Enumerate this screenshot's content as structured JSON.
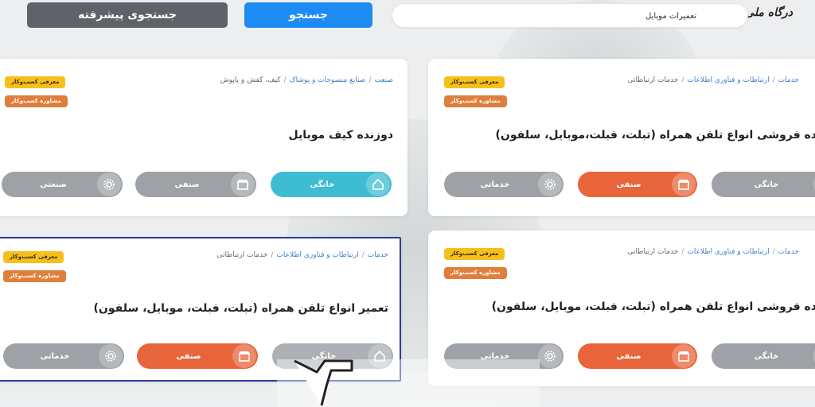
{
  "header": {
    "logo_text": "درگاه ملی مجوزها",
    "search_value": "تعمیرات موبایل",
    "search_button": "جستجو",
    "advanced_button": "جستجوی پیشرفته"
  },
  "badges": {
    "intro": "معرفی کسب‌وکار",
    "consult": "مشاوره کسب‌وکار"
  },
  "categories": {
    "home": "خانگی",
    "guild": "صنفی",
    "service": "خدماتی",
    "industrial": "صنعتی"
  },
  "cards": [
    {
      "breadcrumb": [
        "خدمات",
        "ارتباطات و فناوری اطلاعات",
        "خدمات ارتباطاتی"
      ],
      "title": "ده فروشی انواع تلفن همراه (تبلت، فبلت،موبایل، سلفون)"
    },
    {
      "breadcrumb": [
        "صنعت",
        "صنایع منسوجات و پوشاک",
        "کیف، کفش و پاپوش"
      ],
      "title": "دوزنده کیف موبایل"
    },
    {
      "breadcrumb": [
        "خدمات",
        "ارتباطات و فناوری اطلاعات",
        "خدمات ارتباطاتی"
      ],
      "title": "ده فروشی انواع تلفن همراه (تبلت، فبلت، موبایل، سلفون)"
    },
    {
      "breadcrumb": [
        "خدمات",
        "ارتباطات و فناوری اطلاعات",
        "خدمات ارتباطاتی"
      ],
      "title": "تعمیر انواع تلفن همراه (تبلت، فبلت، موبایل، سلفون)"
    }
  ],
  "colors": {
    "search_button": "#1c8cf4",
    "advanced_button": "#5f6268",
    "category_active_orange": "#e8643a",
    "category_active_teal": "#3dbcd2",
    "category_inactive": "#9ea2a6",
    "badge_intro": "#f6c01c",
    "badge_consult": "#df7f3c",
    "selected_border": "#2b3c97"
  }
}
